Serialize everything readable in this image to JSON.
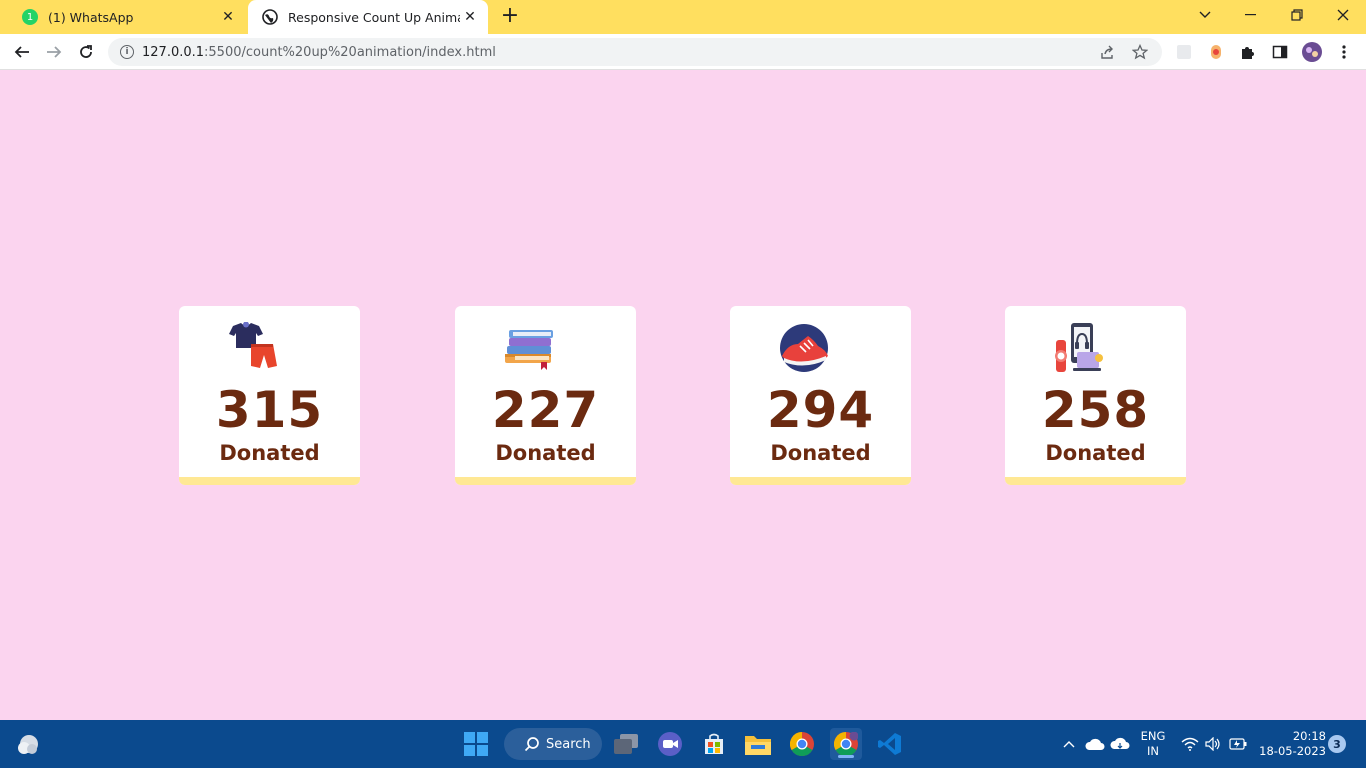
{
  "browser": {
    "tabs": [
      {
        "title": "(1) WhatsApp",
        "badge": "1",
        "active": false
      },
      {
        "title": "Responsive Count Up Animation",
        "active": true
      }
    ],
    "url_host": "127.0.0.1",
    "url_path": ":5500/count%20up%20animation/index.html"
  },
  "cards": [
    {
      "value": "315",
      "label": "Donated",
      "icon": "clothes-icon"
    },
    {
      "value": "227",
      "label": "Donated",
      "icon": "books-icon"
    },
    {
      "value": "294",
      "label": "Donated",
      "icon": "shoe-icon"
    },
    {
      "value": "258",
      "label": "Donated",
      "icon": "gadgets-icon"
    }
  ],
  "taskbar": {
    "search_label": "Search",
    "lang_line1": "ENG",
    "lang_line2": "IN",
    "time": "20:18",
    "date": "18-05-2023",
    "notification_count": "3"
  },
  "colors": {
    "page_background": "#fbd4ef",
    "card_accent": "#ffe894",
    "number_color": "#6b2a10",
    "tabbar": "#ffdf5f",
    "taskbar": "#0b4a8e"
  }
}
